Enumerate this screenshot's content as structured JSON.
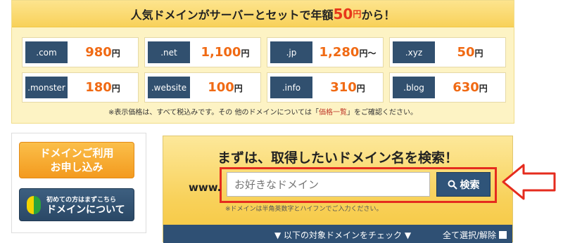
{
  "banner": {
    "title_pre": "人気ドメインがサーバーとセットで年額",
    "title_price": "50",
    "title_unit": "円",
    "title_post": "から！",
    "items": [
      {
        "tld": ".com",
        "price": "980",
        "yen": "円"
      },
      {
        "tld": ".net",
        "price": "1,100",
        "yen": "円"
      },
      {
        "tld": ".jp",
        "price": "1,280",
        "yen": "円～"
      },
      {
        "tld": ".xyz",
        "price": "50",
        "yen": "円"
      },
      {
        "tld": ".monster",
        "price": "180",
        "yen": "円"
      },
      {
        "tld": ".website",
        "price": "100",
        "yen": "円"
      },
      {
        "tld": ".info",
        "price": "310",
        "yen": "円"
      },
      {
        "tld": ".blog",
        "price": "630",
        "yen": "円"
      }
    ],
    "note_pre": "※表示価格は、すべて税込みです。その 他のドメインについては「",
    "note_link": "価格一覧",
    "note_post": "」をご確認ください。"
  },
  "left": {
    "apply_line1": "ドメインご利用",
    "apply_line2": "お申し込み",
    "about_sub": "初めての方はまずこちら",
    "about_main": "ドメインについて"
  },
  "search": {
    "title": "まずは、取得したいドメイン名を検索！",
    "prefix": "www.",
    "placeholder": "お好きなドメイン",
    "button_label": "検索",
    "hint": "※ドメインは半角英数字とハイフンでご入力ください。",
    "check_label": "▼ 以下の対象ドメインをチェック ▼",
    "select_all_label": "全て選択/解除"
  },
  "colors": {
    "accent_orange": "#f06a14",
    "navy": "#2f5074",
    "highlight_red": "#e52b1e"
  }
}
